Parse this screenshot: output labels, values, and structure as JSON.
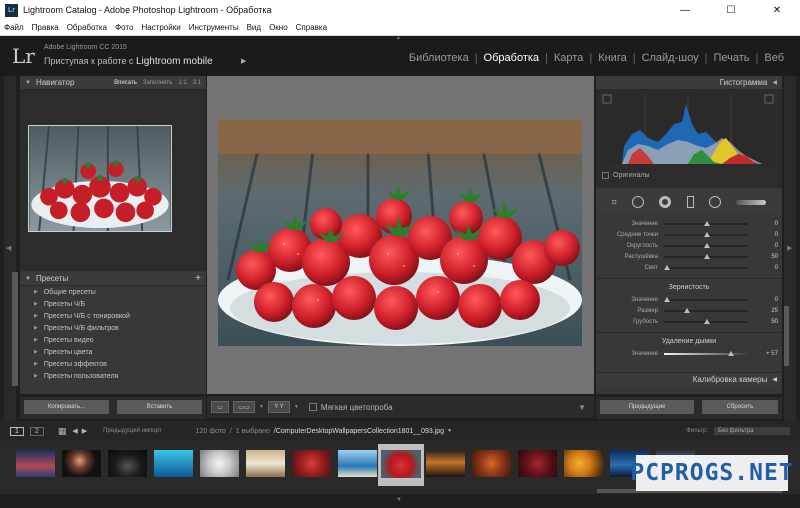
{
  "window": {
    "title": "Lightroom Catalog - Adobe Photoshop Lightroom - Обработка",
    "controls": {
      "minimize": "—",
      "maximize": "☐",
      "close": "✕"
    }
  },
  "menu": [
    "Файл",
    "Правка",
    "Обработка",
    "Фото",
    "Настройки",
    "Инструменты",
    "Вид",
    "Окно",
    "Справка"
  ],
  "identity": {
    "logo": "Lr",
    "product": "Adobe Lightroom CC 2015",
    "mobile_prefix": "Приступая к работе с",
    "mobile_link": "Lightroom mobile",
    "arrow": "▶"
  },
  "modules": [
    "Библиотека",
    "Обработка",
    "Карта",
    "Книга",
    "Слайд-шоу",
    "Печать",
    "Веб"
  ],
  "active_module": "Обработка",
  "left_panel": {
    "navigator": {
      "title": "Навигатор",
      "options": [
        "Вписать",
        "Заполнить",
        "1:1",
        "3:1"
      ]
    },
    "presets": {
      "title": "Пресеты",
      "add": "+",
      "items": [
        "Общие пресеты",
        "Пресеты Ч/Б",
        "Пресеты Ч/Б с тонировкой",
        "Пресеты Ч/Б фильтров",
        "Пресеты видео",
        "Пресеты цвета",
        "Пресеты эффектов",
        "Пресеты пользователя"
      ]
    },
    "buttons": {
      "copy": "Копировать...",
      "paste": "Вставить"
    }
  },
  "toolbar": {
    "view_loupe": "▭",
    "view_compare": "Y Y",
    "soft_proof_label": "Мягкая цветопроба",
    "dropdown": "▼"
  },
  "right_panel": {
    "histogram": {
      "title": "Гистограмма",
      "originals_label": "Оригиналы"
    },
    "sliders_top": [
      {
        "label": "Значение",
        "value": "0"
      },
      {
        "label": "Средние точки",
        "value": "0"
      },
      {
        "label": "Округлость",
        "value": "0"
      },
      {
        "label": "Растушёвка",
        "value": "50"
      },
      {
        "label": "Свет",
        "value": "0"
      }
    ],
    "grain": {
      "title": "Зернистость",
      "sliders": [
        {
          "label": "Значение",
          "value": "0"
        },
        {
          "label": "Размер",
          "value": "25"
        },
        {
          "label": "Грубость",
          "value": "50"
        }
      ]
    },
    "dehaze": {
      "title": "Удаление дымки",
      "slider": {
        "label": "Значение",
        "value": "+ 57"
      }
    },
    "calibration": "Калибровка камеры",
    "buttons": {
      "previous": "Предыдущие",
      "reset": "Сбросить"
    }
  },
  "filmstrip": {
    "pages": [
      "1",
      "2"
    ],
    "source": "Предыдущий импорт",
    "count": "120 фото",
    "selected": "1 выбрано",
    "filename": "/ComputerDesktopWallpapersCollection1801__093.jpg",
    "filter_label": "Фильтр:",
    "filter_value": "Без фильтра"
  },
  "watermark": "PCPROGS.NET",
  "colors": {
    "accent": "#ffffff",
    "panel": "#383838",
    "background": "#1f1f1f",
    "strawberry": "#d0202b"
  },
  "thumbnails": [
    "sunset-lake",
    "dark-portrait",
    "dark-car",
    "blue-car",
    "white-animal",
    "bathroom",
    "strawberries-red",
    "blue-sea",
    "strawberries-selected",
    "desert-sunset",
    "food-platter",
    "berries",
    "citrus",
    "ocean-city",
    "storm-clouds"
  ]
}
